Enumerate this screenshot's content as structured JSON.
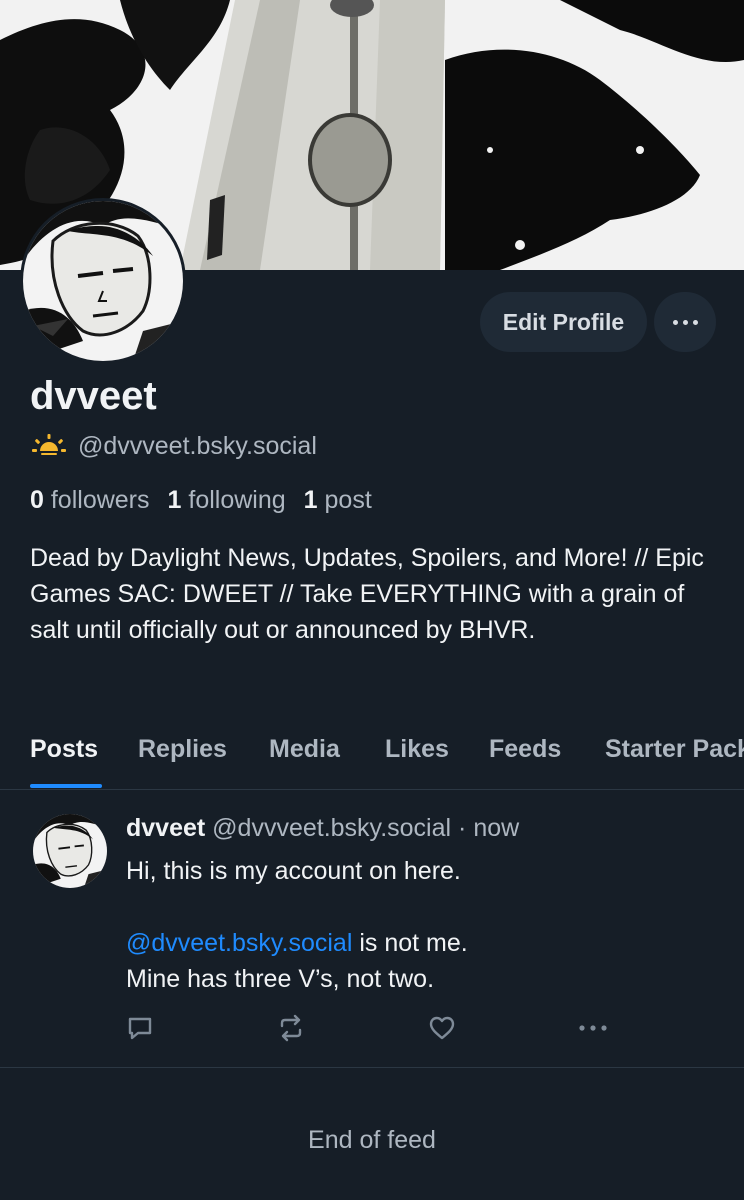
{
  "profile": {
    "display_name": "dvveet",
    "handle": "@dvvveet.bsky.social",
    "edit_button_label": "Edit Profile",
    "stats": {
      "followers_count": "0",
      "followers_label": "followers",
      "following_count": "1",
      "following_label": "following",
      "posts_count": "1",
      "posts_label": "post"
    },
    "bio": "Dead by Daylight News, Updates, Spoilers, and More! // Epic Games SAC: DWEET // Take EVERYTHING with a grain of salt until officially out or announced by BHVR.",
    "badge_icon": "sun-icon"
  },
  "tabs": [
    {
      "label": "Posts",
      "active": true
    },
    {
      "label": "Replies",
      "active": false
    },
    {
      "label": "Media",
      "active": false
    },
    {
      "label": "Likes",
      "active": false
    },
    {
      "label": "Feeds",
      "active": false
    },
    {
      "label": "Starter Packs",
      "active": false
    }
  ],
  "post": {
    "author_name": "dvveet",
    "author_handle": "@dvvveet.bsky.social",
    "separator": "·",
    "time": "now",
    "line1": "Hi, this is my account on here.",
    "mention": "@dvveet.bsky.social",
    "mention_suffix": " is not me.",
    "line3": "Mine has three V’s, not two.",
    "actions": [
      "reply-icon",
      "repost-icon",
      "like-icon",
      "more-icon"
    ]
  },
  "feed_end_label": "End of feed",
  "colors": {
    "background": "#161e27",
    "button_bg": "#1f2a36",
    "accent": "#1f8bfe",
    "muted_text": "#aeb7c1",
    "sun_badge": "#f5b82e"
  }
}
